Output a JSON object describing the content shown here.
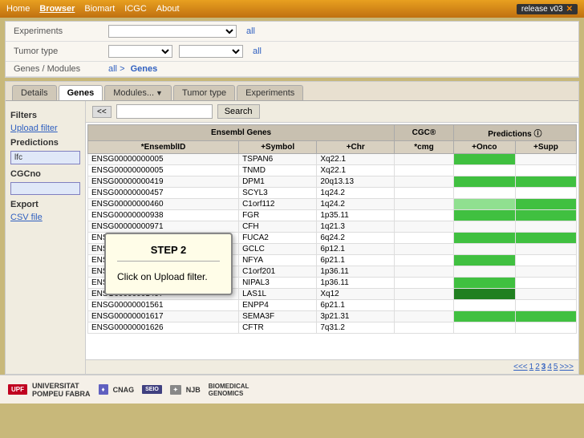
{
  "topbar": {
    "nav": [
      "Home",
      "Browser",
      "Biomart",
      "ICGC",
      "About"
    ],
    "active": "Browser",
    "release": "release v03",
    "close_label": "✕"
  },
  "filters": {
    "experiments_label": "Experiments",
    "experiments_all": "all",
    "tumor_type_label": "Tumor type",
    "tumor_type_all": "all",
    "genes_modules_label": "Genes / Modules",
    "genes_link": "all",
    "genes_sep": ">",
    "genes_active": "Genes"
  },
  "tabs": [
    {
      "label": "Details",
      "active": false
    },
    {
      "label": "Genes",
      "active": true
    },
    {
      "label": "Modules...",
      "active": false,
      "has_arrow": true
    },
    {
      "label": "Tumor type",
      "active": false
    },
    {
      "label": "Experiments",
      "active": false
    }
  ],
  "sidebar": {
    "filters_title": "Filters",
    "upload_filter": "Upload filter",
    "predictions_title": "Predictions",
    "cgc_title": "CGCno",
    "export_title": "Export",
    "csv_file": "CSV file"
  },
  "search": {
    "nav_prev": "<<",
    "placeholder": "",
    "button": "Search"
  },
  "table": {
    "group_headers": [
      "Ensembl Genes",
      "CGCⓇ",
      "Predictions ⓘ"
    ],
    "columns": [
      "EnsemblID",
      "+Symbol",
      "+Chr",
      "*cmg",
      "+Onco",
      "+Supp"
    ],
    "rows": [
      {
        "id": "ENSG00000000005",
        "symbol": "TSPAN6",
        "chr": "Xq22.1",
        "cmg": "",
        "onco": "green",
        "supp": ""
      },
      {
        "id": "ENSG00000000005",
        "symbol": "TNMD",
        "chr": "Xq22.1",
        "cmg": "",
        "onco": "",
        "supp": ""
      },
      {
        "id": "ENSG00000000419",
        "symbol": "DPM1",
        "chr": "20q13.13",
        "cmg": "",
        "onco": "green",
        "supp": "green"
      },
      {
        "id": "ENSG00000000457",
        "symbol": "SCYL3",
        "chr": "1q24.2",
        "cmg": "",
        "onco": "",
        "supp": ""
      },
      {
        "id": "ENSG00000000460",
        "symbol": "C1orf112",
        "chr": "1q24.2",
        "cmg": "",
        "onco": "light-green",
        "supp": "green"
      },
      {
        "id": "ENSG00000000938",
        "symbol": "FGR",
        "chr": "1p35.11",
        "cmg": "",
        "onco": "green",
        "supp": "green"
      },
      {
        "id": "ENSG00000000971",
        "symbol": "CFH",
        "chr": "1q21.3",
        "cmg": "",
        "onco": "",
        "supp": ""
      },
      {
        "id": "ENSG00000001036",
        "symbol": "FUCA2",
        "chr": "6q24.2",
        "cmg": "",
        "onco": "green",
        "supp": "green"
      },
      {
        "id": "ENSG00000001084",
        "symbol": "GCLC",
        "chr": "6p12.1",
        "cmg": "",
        "onco": "",
        "supp": ""
      },
      {
        "id": "ENSG00000001167",
        "symbol": "NFYA",
        "chr": "6p21.1",
        "cmg": "",
        "onco": "green",
        "supp": ""
      },
      {
        "id": "ENSG00000001460",
        "symbol": "C1orf201",
        "chr": "1p36.11",
        "cmg": "",
        "onco": "",
        "supp": ""
      },
      {
        "id": "ENSG00000001461",
        "symbol": "NIPAL3",
        "chr": "1p36.11",
        "cmg": "",
        "onco": "green",
        "supp": ""
      },
      {
        "id": "ENSG00000001497",
        "symbol": "LAS1L",
        "chr": "Xq12",
        "cmg": "",
        "onco": "dark-green",
        "supp": ""
      },
      {
        "id": "ENSG00000001561",
        "symbol": "ENPP4",
        "chr": "6p21.1",
        "cmg": "",
        "onco": "",
        "supp": ""
      },
      {
        "id": "ENSG00000001617",
        "symbol": "SEMA3F",
        "chr": "3p21.31",
        "cmg": "",
        "onco": "green",
        "supp": "green"
      },
      {
        "id": "ENSG00000001626",
        "symbol": "CFTR",
        "chr": "7q31.2",
        "cmg": "",
        "onco": "",
        "supp": ""
      }
    ]
  },
  "pagination": {
    "text": "<<< 1 2 3 4 5 >>>"
  },
  "popup": {
    "step": "STEP 2",
    "desc": "Click on Upload filter."
  },
  "footer": {
    "logos": [
      "UPF",
      "CNAG",
      "SEIO",
      "NJB",
      "BIOMEDICAL GENOMICS"
    ]
  }
}
